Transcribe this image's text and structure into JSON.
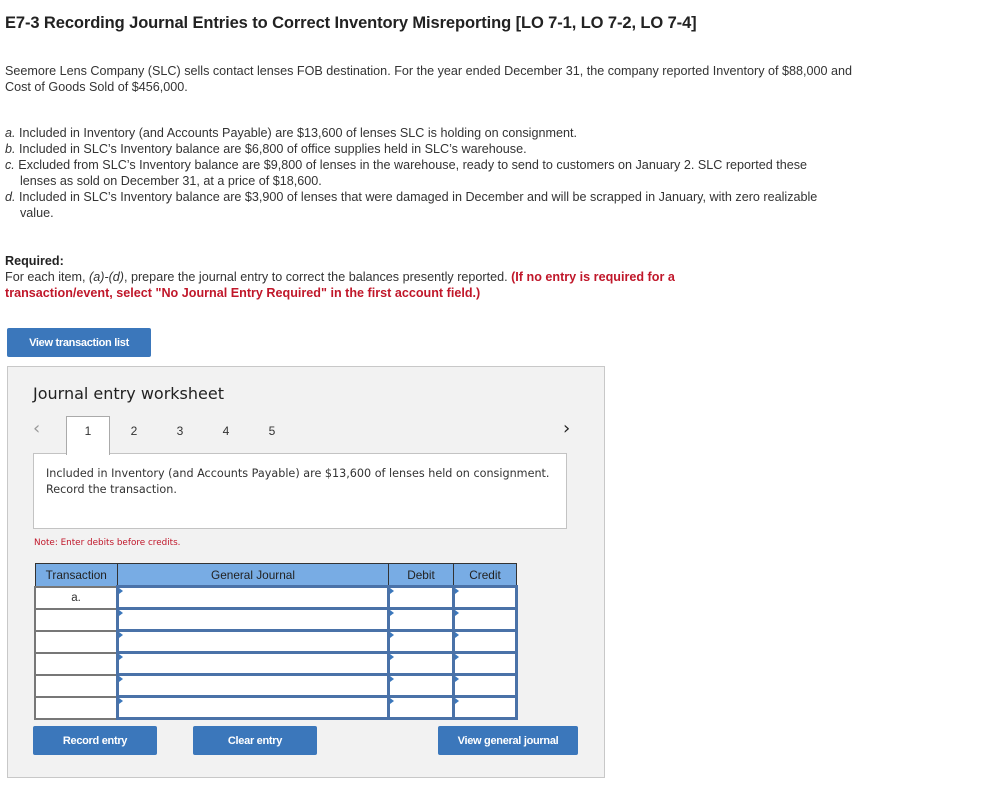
{
  "header": {
    "title": "E7-3 Recording Journal Entries to Correct Inventory Misreporting [LO 7-1, LO 7-2, LO 7-4]"
  },
  "intro": "Seemore Lens Company (SLC) sells contact lenses FOB destination. For the year ended December 31, the company reported Inventory of $88,000 and Cost of Goods Sold of $456,000.",
  "items": [
    {
      "letter": "a.",
      "text": " Included in Inventory (and Accounts Payable) are $13,600 of lenses SLC is holding on consignment."
    },
    {
      "letter": "b.",
      "text": " Included in SLC’s Inventory balance are $6,800 of office supplies held in SLC’s warehouse."
    },
    {
      "letter": "c.",
      "text": " Excluded from SLC’s Inventory balance are $9,800 of lenses in the warehouse, ready to send to customers on January 2. SLC reported these lenses as sold on December 31, at a price of $18,600."
    },
    {
      "letter": "d.",
      "text": " Included in SLC’s Inventory balance are $3,900 of lenses that were damaged in December and will be scrapped in January, with zero realizable value."
    }
  ],
  "required": {
    "label": "Required:",
    "text_before": "For each item, ",
    "text_italic": "(a)-(d)",
    "text_after": ", prepare the journal entry to correct the balances presently reported. ",
    "instruction": "(If no entry is required for a transaction/event, select \"No Journal Entry Required\" in the first account field.)"
  },
  "buttons": {
    "view_transaction_list": "View transaction list",
    "record_entry": "Record entry",
    "clear_entry": "Clear entry",
    "view_general_journal": "View general journal"
  },
  "worksheet": {
    "title": "Journal entry worksheet",
    "prev_icon": "‹",
    "next_icon": "›",
    "tabs": [
      "1",
      "2",
      "3",
      "4",
      "5"
    ],
    "active_tab": "1",
    "description": "Included in Inventory (and Accounts Payable) are $13,600 of lenses held on consignment. Record the transaction.",
    "note": "Note: Enter debits before credits.",
    "table": {
      "headers": [
        "Transaction",
        "General Journal",
        "Debit",
        "Credit"
      ],
      "rows": [
        {
          "transaction": "a.",
          "account": "",
          "debit": "",
          "credit": ""
        },
        {
          "transaction": "",
          "account": "",
          "debit": "",
          "credit": ""
        },
        {
          "transaction": "",
          "account": "",
          "debit": "",
          "credit": ""
        },
        {
          "transaction": "",
          "account": "",
          "debit": "",
          "credit": ""
        },
        {
          "transaction": "",
          "account": "",
          "debit": "",
          "credit": ""
        },
        {
          "transaction": "",
          "account": "",
          "debit": "",
          "credit": ""
        }
      ]
    }
  },
  "colors": {
    "button_blue": "#3b77bb",
    "header_blue": "#78ace4",
    "instruction_red": "#c0172a",
    "panel_gray": "#f2f2f2"
  }
}
